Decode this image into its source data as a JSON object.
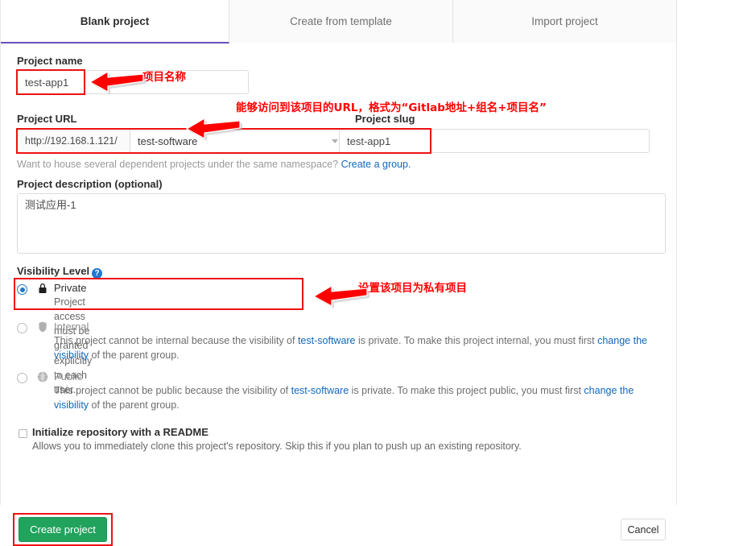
{
  "tabs": [
    {
      "label": "Blank project",
      "active": true
    },
    {
      "label": "Create from template",
      "active": false
    },
    {
      "label": "Import project",
      "active": false
    }
  ],
  "project_name": {
    "label": "Project name",
    "value": "test-app1"
  },
  "project_url": {
    "label": "Project URL",
    "prefix": "http://192.168.1.121/",
    "namespace": "test-software",
    "slug_label": "Project slug",
    "slug_value": "test-app1",
    "hint_text": "Want to house several dependent projects under the same namespace?",
    "hint_link": "Create a group."
  },
  "description": {
    "label": "Project description (optional)",
    "value": "测试应用-1"
  },
  "visibility": {
    "label": "Visibility Level",
    "help_icon": "question-mark-icon",
    "options": [
      {
        "icon": "lock-icon",
        "title": "Private",
        "desc": "Project access must be granted explicitly to each user.",
        "selected": true,
        "disabled": false
      },
      {
        "icon": "shield-icon",
        "title": "Internal",
        "desc_part1": "This project cannot be internal because the visibility of ",
        "desc_group": "test-software",
        "desc_part2": " is private. To make this project internal, you must first ",
        "desc_link": "change the visibility",
        "desc_part3": " of the parent group.",
        "selected": false,
        "disabled": true
      },
      {
        "icon": "globe-icon",
        "title": "Public",
        "desc_part1": "This project cannot be public because the visibility of ",
        "desc_group": "test-software",
        "desc_part2": " is private. To make this project public, you must first ",
        "desc_link": "change the visibility",
        "desc_part3": " of the parent group.",
        "selected": false,
        "disabled": true
      }
    ]
  },
  "readme": {
    "title": "Initialize repository with a README",
    "desc": "Allows you to immediately clone this project's repository. Skip this if you plan to push up an existing repository.",
    "checked": false
  },
  "buttons": {
    "create": "Create project",
    "cancel": "Cancel"
  },
  "annotations": {
    "project_name": "项目名称",
    "project_url": "能够访问到该项目的URL，格式为“Gitlab地址+组名+项目名”",
    "visibility": "设置该项目为私有项目"
  },
  "colors": {
    "annotation_red": "#ff0000",
    "tab_active_underline": "#6b4fbb",
    "create_button_green": "#21a35d",
    "link_blue": "#1068bf",
    "radio_blue": "#1f78d1"
  }
}
